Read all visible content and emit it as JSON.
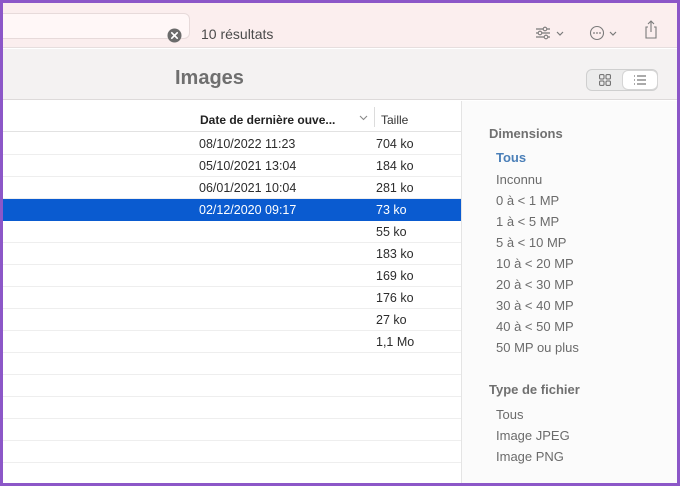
{
  "toolbar": {
    "results_text": "10 résultats",
    "icons": [
      "clear-search-icon",
      "filter-options-icon",
      "more-options-icon",
      "share-icon"
    ]
  },
  "window": {
    "title": "Images"
  },
  "view_switcher": {
    "options": [
      "grid-view-icon",
      "list-view-icon"
    ],
    "selected": "list"
  },
  "list": {
    "columns": {
      "date": "Date de dernière ouve...",
      "size": "Taille"
    },
    "rows": [
      {
        "date": "08/10/2022 11:23",
        "size": "704 ko",
        "selected": false
      },
      {
        "date": "05/10/2021 13:04",
        "size": "184 ko",
        "selected": false
      },
      {
        "date": "06/01/2021 10:04",
        "size": "281 ko",
        "selected": false
      },
      {
        "date": "02/12/2020 09:17",
        "size": "73 ko",
        "selected": true
      },
      {
        "date": "",
        "size": "55 ko",
        "selected": false
      },
      {
        "date": "",
        "size": "183 ko",
        "selected": false
      },
      {
        "date": "",
        "size": "169 ko",
        "selected": false
      },
      {
        "date": "",
        "size": "176 ko",
        "selected": false
      },
      {
        "date": "",
        "size": "27 ko",
        "selected": false
      },
      {
        "date": "",
        "size": "1,1 Mo",
        "selected": false
      }
    ]
  },
  "filters": {
    "dimensions": {
      "title": "Dimensions",
      "options": [
        "Tous",
        "Inconnu",
        "0 à < 1 MP",
        "1 à < 5 MP",
        "5 à < 10 MP",
        "10 à < 20 MP",
        "20 à < 30 MP",
        "30 à < 40 MP",
        "40 à < 50 MP",
        "50 MP ou plus"
      ],
      "active": "Tous"
    },
    "file_type": {
      "title": "Type de fichier",
      "options": [
        "Tous",
        "Image JPEG",
        "Image PNG"
      ]
    }
  },
  "colors": {
    "selection": "#0a5bd0",
    "active_filter": "#4a7fb8",
    "frame": "#8c57c8"
  }
}
